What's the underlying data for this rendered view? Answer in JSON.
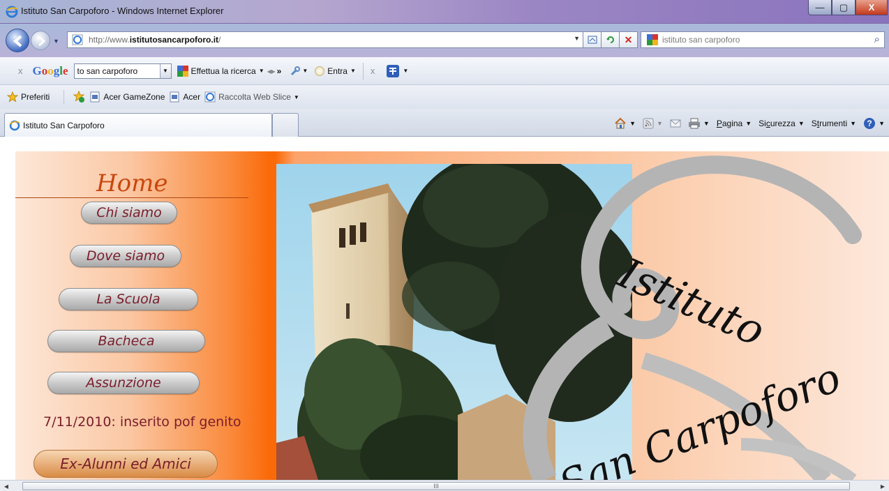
{
  "window": {
    "title": "Istituto San Carpoforo - Windows Internet Explorer",
    "buttons": [
      "—",
      "▢",
      "X"
    ]
  },
  "address_bar": {
    "url_prefix": "http://www.",
    "url_domain": "istitutosancarpoforo.it",
    "url_suffix": "/",
    "search_value": "istituto san carpoforo"
  },
  "google_toolbar": {
    "close": "x",
    "logo_letters": [
      "G",
      "o",
      "o",
      "g",
      "l",
      "e"
    ],
    "logo_colors": [
      "#3b6fd8",
      "#d8352a",
      "#f1b41f",
      "#3b6fd8",
      "#2a9b3b",
      "#d8352a"
    ],
    "query_value": "to san carpoforo",
    "search_label": "Effettua la ricerca",
    "more": "»",
    "signin_label": "Entra",
    "close2": "x"
  },
  "favorites_bar": {
    "favorites_label": "Preferiti",
    "items": [
      "Acer GameZone",
      "Acer",
      "Raccolta Web Slice"
    ]
  },
  "tabs": {
    "active_tab_label": "Istituto San Carpoforo"
  },
  "command_bar": {
    "pagina": {
      "u": "P",
      "rest": "agina"
    },
    "sicurezza": {
      "pre": "Si",
      "u": "c",
      "rest": "urezza"
    },
    "strumenti": {
      "pre": "S",
      "u": "t",
      "rest": "rumenti"
    }
  },
  "site": {
    "home_title": "Home",
    "nav": [
      "Chi siamo",
      "Dove siamo",
      "La Scuola",
      "Bacheca",
      "Assunzione"
    ],
    "news": "7/11/2010: inserito pof genito",
    "ex_alumni": "Ex-Alunni ed Amici",
    "brand_line1": "Istituto",
    "brand_line2": "San Carpoforo",
    "colors": {
      "orange": "#fb6a08",
      "nav_text": "#7a1d2a",
      "home_text": "#c8470f",
      "ampersand_gray": "#b4b4b4"
    }
  },
  "scrollbar": {
    "grip": "III"
  }
}
